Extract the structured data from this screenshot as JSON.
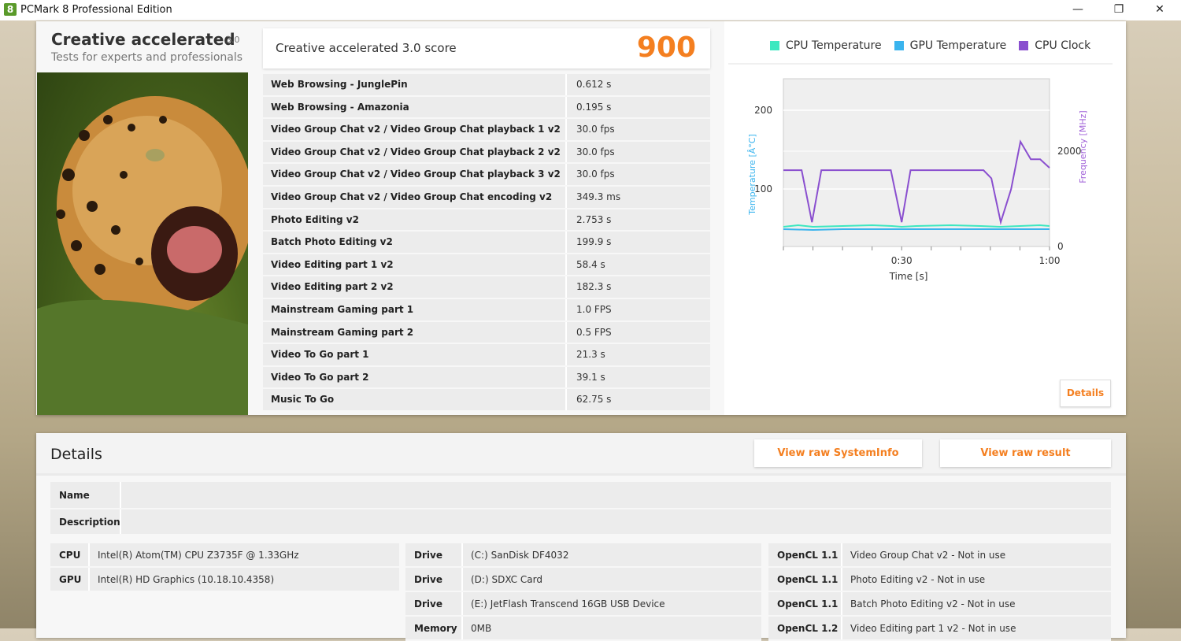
{
  "window": {
    "title": "PCMark 8 Professional Edition",
    "icon_text": "8",
    "minimize": "—",
    "restore": "❐",
    "close": "✕"
  },
  "card": {
    "title": "Creative accelerated",
    "version": "3.0",
    "subtitle": "Tests for experts and professionals"
  },
  "score": {
    "label": "Creative accelerated 3.0 score",
    "value": "900"
  },
  "results": [
    {
      "name": "Web Browsing - JunglePin",
      "value": "0.612 s"
    },
    {
      "name": "Web Browsing - Amazonia",
      "value": "0.195 s"
    },
    {
      "name": "Video Group Chat v2 / Video Group Chat playback 1 v2",
      "value": "30.0 fps"
    },
    {
      "name": "Video Group Chat v2 / Video Group Chat playback 2 v2",
      "value": "30.0 fps"
    },
    {
      "name": "Video Group Chat v2 / Video Group Chat playback 3 v2",
      "value": "30.0 fps"
    },
    {
      "name": "Video Group Chat v2 / Video Group Chat encoding v2",
      "value": "349.3 ms"
    },
    {
      "name": "Photo Editing v2",
      "value": "2.753 s"
    },
    {
      "name": "Batch Photo Editing v2",
      "value": "199.9 s"
    },
    {
      "name": "Video Editing part 1 v2",
      "value": "58.4 s"
    },
    {
      "name": "Video Editing part 2 v2",
      "value": "182.3 s"
    },
    {
      "name": "Mainstream Gaming part 1",
      "value": "1.0 FPS"
    },
    {
      "name": "Mainstream Gaming part 2",
      "value": "0.5 FPS"
    },
    {
      "name": "Video To Go part 1",
      "value": "21.3 s"
    },
    {
      "name": "Video To Go part 2",
      "value": "39.1 s"
    },
    {
      "name": "Music To Go",
      "value": "62.75 s"
    }
  ],
  "chart_data": {
    "type": "line",
    "legend": [
      "CPU Temperature",
      "GPU Temperature",
      "CPU Clock"
    ],
    "colors": {
      "cpu_temp": "#3de8c0",
      "gpu_temp": "#3ab4ee",
      "cpu_clock": "#8a4fcf"
    },
    "xlabel": "Time [s]",
    "ylabel_left": "Temperature [Â°C]",
    "ylabel_right": "Frequency [MHz]",
    "xlim": [
      6,
      60
    ],
    "ylim_left": [
      27,
      240
    ],
    "ylim_right": [
      0,
      3520
    ],
    "xticks": [
      {
        "v": 30,
        "label": "0:30"
      },
      {
        "v": 60,
        "label": "1:00"
      }
    ],
    "yticks_left": [
      {
        "v": 100,
        "label": "100"
      },
      {
        "v": 200,
        "label": "200"
      }
    ],
    "yticks_right": [
      {
        "v": 0,
        "label": "0"
      },
      {
        "v": 2000,
        "label": "2000"
      }
    ],
    "series": [
      {
        "name": "CPU Temperature",
        "axis": "left",
        "color": "#3de8c0",
        "x": [
          6,
          9,
          12,
          18,
          24,
          28,
          30,
          33,
          40,
          46,
          50,
          54,
          58,
          60
        ],
        "y": [
          52,
          54,
          52,
          53,
          54,
          53,
          52,
          53,
          54,
          53,
          52,
          53,
          54,
          53
        ]
      },
      {
        "name": "GPU Temperature",
        "axis": "left",
        "color": "#3ab4ee",
        "x": [
          6,
          12,
          18,
          24,
          30,
          36,
          42,
          48,
          54,
          60
        ],
        "y": [
          49,
          48,
          49,
          49,
          49,
          49,
          49,
          49,
          49,
          49
        ]
      },
      {
        "name": "CPU Clock",
        "axis": "right",
        "color": "#8a4fcf",
        "x": [
          6,
          9.7,
          11.8,
          13.7,
          27.8,
          30,
          31.8,
          46.6,
          48.2,
          50.1,
          52.2,
          54.1,
          56.2,
          58.1,
          60
        ],
        "y": [
          1600,
          1600,
          510,
          1600,
          1600,
          510,
          1600,
          1600,
          1430,
          510,
          1200,
          2200,
          1830,
          1830,
          1650
        ]
      }
    ]
  },
  "chart_panel": {
    "details_button": "Details"
  },
  "details": {
    "title": "Details",
    "view_sysinfo": "View raw SystemInfo",
    "view_result": "View raw result",
    "name_label": "Name",
    "name_value": "",
    "description_label": "Description",
    "description_value": "",
    "system": [
      {
        "k": "CPU",
        "v": "Intel(R) Atom(TM) CPU  Z3735F @ 1.33GHz"
      },
      {
        "k": "GPU",
        "v": "Intel(R) HD Graphics (10.18.10.4358)"
      }
    ],
    "drives": [
      {
        "k": "Drive",
        "v": "(C:) SanDisk DF4032"
      },
      {
        "k": "Drive",
        "v": "(D:) SDXC Card"
      },
      {
        "k": "Drive",
        "v": "(E:) JetFlash Transcend 16GB USB Device"
      },
      {
        "k": "Memory",
        "v": "0MB"
      }
    ],
    "opencl": [
      {
        "k": "OpenCL 1.1",
        "v": "Video Group Chat v2 - Not in use"
      },
      {
        "k": "OpenCL 1.1",
        "v": "Photo Editing v2 - Not in use"
      },
      {
        "k": "OpenCL 1.1",
        "v": "Batch Photo Editing v2 - Not in use"
      },
      {
        "k": "OpenCL 1.2",
        "v": "Video Editing part 1 v2 - Not in use"
      }
    ]
  }
}
